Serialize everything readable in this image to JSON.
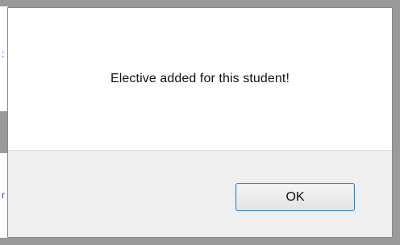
{
  "dialog": {
    "message": "Elective added for this student!",
    "ok_label": "OK"
  }
}
